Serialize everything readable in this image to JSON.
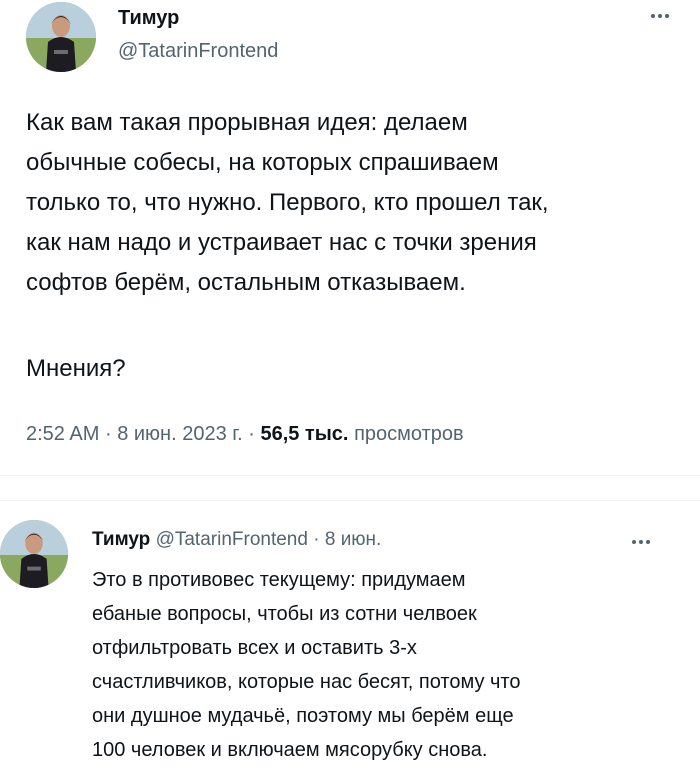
{
  "main_tweet": {
    "author_name": "Тимур",
    "author_handle": "@TatarinFrontend",
    "text": "Как вам такая прорывная идея: делаем\nобычные собесы, на которых спрашиваем\nтолько то, что нужно. Первого, кто прошел так,\nкак нам надо и устраивает нас с точки зрения\nсофтов берём, остальным отказываем.",
    "question": "Мнения?",
    "time": "2:52 AM",
    "date": "8 июн. 2023 г.",
    "separator": "·",
    "views_count": "56,5 тыс.",
    "views_label": "просмотров",
    "more_icon": "more-icon"
  },
  "reply_tweet": {
    "author_name": "Тимур",
    "author_handle": "@TatarinFrontend",
    "separator": "·",
    "date": "8 июн.",
    "text": "Это в противовес текущему: придумаем\nебаные вопросы, чтобы из сотни челвоек\nотфильтровать всех и оставить 3-х\nсчастливчиков, которые нас бесят, потому что\nони душное мудачьё, поэтому мы берём еще\n100 человек и включаем мясорубку снова.",
    "more_icon": "more-icon"
  },
  "colors": {
    "text_primary": "#0f1419",
    "text_secondary": "#536471",
    "divider": "#eff3f4"
  }
}
